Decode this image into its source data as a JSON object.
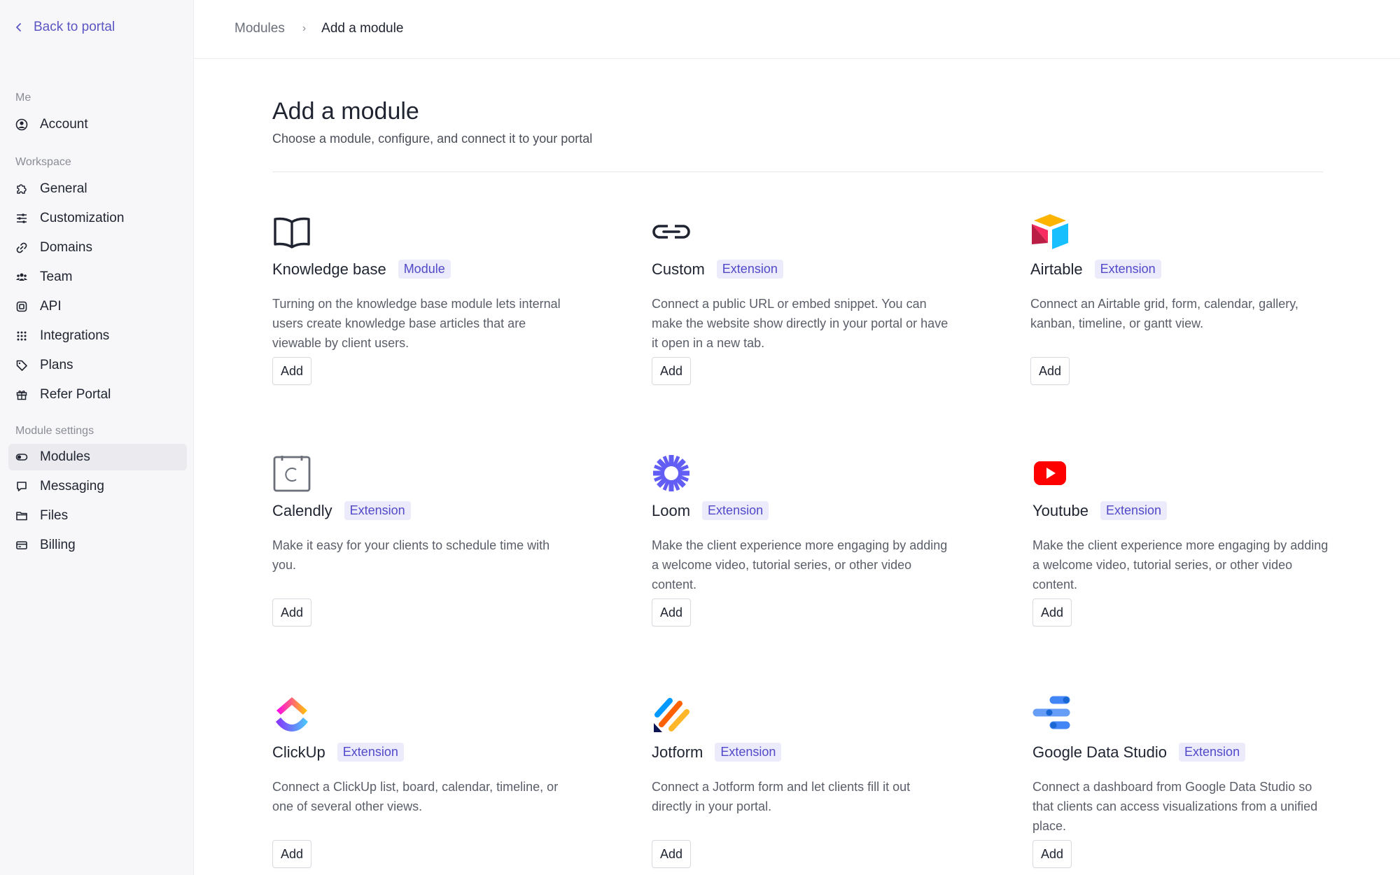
{
  "sidebar": {
    "back_label": "Back to portal",
    "sections": {
      "me": "Me",
      "workspace": "Workspace",
      "module_settings": "Module settings"
    },
    "items": [
      {
        "label": "Account",
        "icon": "user-circle-icon"
      },
      {
        "label": "General",
        "icon": "puzzle-icon"
      },
      {
        "label": "Customization",
        "icon": "sliders-icon"
      },
      {
        "label": "Domains",
        "icon": "link-icon"
      },
      {
        "label": "Team",
        "icon": "team-icon"
      },
      {
        "label": "API",
        "icon": "api-icon"
      },
      {
        "label": "Integrations",
        "icon": "grid-icon"
      },
      {
        "label": "Plans",
        "icon": "tag-icon"
      },
      {
        "label": "Refer Portal",
        "icon": "gift-icon"
      },
      {
        "label": "Modules",
        "icon": "toggle-icon",
        "active": true
      },
      {
        "label": "Messaging",
        "icon": "chat-icon"
      },
      {
        "label": "Files",
        "icon": "folder-icon"
      },
      {
        "label": "Billing",
        "icon": "credit-card-icon"
      }
    ]
  },
  "breadcrumb": {
    "parent": "Modules",
    "current": "Add a module"
  },
  "header": {
    "title": "Add a module",
    "subtitle": "Choose a module, configure, and connect it to your portal"
  },
  "cards": [
    {
      "name": "Knowledge base",
      "badge": "Module",
      "icon": "book-icon",
      "description": "Turning on the knowledge base module lets internal users create knowledge base articles that are viewable by client users.",
      "action": "Add"
    },
    {
      "name": "Custom",
      "badge": "Extension",
      "icon": "link-icon",
      "description": "Connect a public URL or embed snippet. You can make the website show directly in your portal or have it open in a new tab.",
      "action": "Add"
    },
    {
      "name": "Airtable",
      "badge": "Extension",
      "icon": "airtable-logo-icon",
      "description": "Connect an Airtable grid, form, calendar, gallery, kanban, timeline, or gantt view.",
      "action": "Add"
    },
    {
      "name": "Calendly",
      "badge": "Extension",
      "icon": "calendly-logo-icon",
      "description": "Make it easy for your clients to schedule time with you.",
      "action": "Add"
    },
    {
      "name": "Loom",
      "badge": "Extension",
      "icon": "loom-logo-icon",
      "description": "Make the client experience more engaging by adding a welcome video, tutorial series, or other video content.",
      "action": "Add"
    },
    {
      "name": "Youtube",
      "badge": "Extension",
      "icon": "youtube-logo-icon",
      "description": "Make the client experience more engaging by adding a welcome video, tutorial series, or other video content.",
      "action": "Add"
    },
    {
      "name": "ClickUp",
      "badge": "Extension",
      "icon": "clickup-logo-icon",
      "description": "Connect a ClickUp list, board, calendar, timeline, or one of several other views.",
      "action": "Add"
    },
    {
      "name": "Jotform",
      "badge": "Extension",
      "icon": "jotform-logo-icon",
      "description": "Connect a Jotform form and let clients fill it out directly in your portal.",
      "action": "Add"
    },
    {
      "name": "Google Data Studio",
      "badge": "Extension",
      "icon": "google-data-studio-logo-icon",
      "description": "Connect a dashboard from Google Data Studio so that clients can access visualizations from a unified place.",
      "action": "Add"
    }
  ],
  "colors": {
    "accent": "#5b55c4",
    "badge_bg": "#ecebfb",
    "sidebar_bg": "#f7f7f9"
  }
}
